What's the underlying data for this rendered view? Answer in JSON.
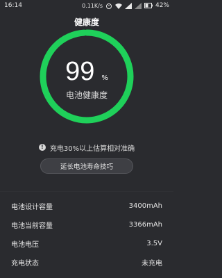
{
  "status_bar": {
    "time": "16:14",
    "network_speed": "0.11K/s",
    "battery_percent": "42%"
  },
  "header": {
    "title": "健康度"
  },
  "gauge": {
    "value": "99",
    "unit": "%",
    "label": "电池健康度",
    "level": 0.99,
    "ring_color": "#1fd05a"
  },
  "hint": {
    "text": "充电30%以上估算相对准确",
    "icon": "info-icon"
  },
  "tips_button": {
    "label": "延长电池寿命技巧"
  },
  "info": {
    "rows": [
      {
        "label": "电池设计容量",
        "value": "3400mAh"
      },
      {
        "label": "电池当前容量",
        "value": "3366mAh"
      },
      {
        "label": "电池电压",
        "value": "3.5V"
      },
      {
        "label": "充电状态",
        "value": "未充电"
      }
    ]
  }
}
